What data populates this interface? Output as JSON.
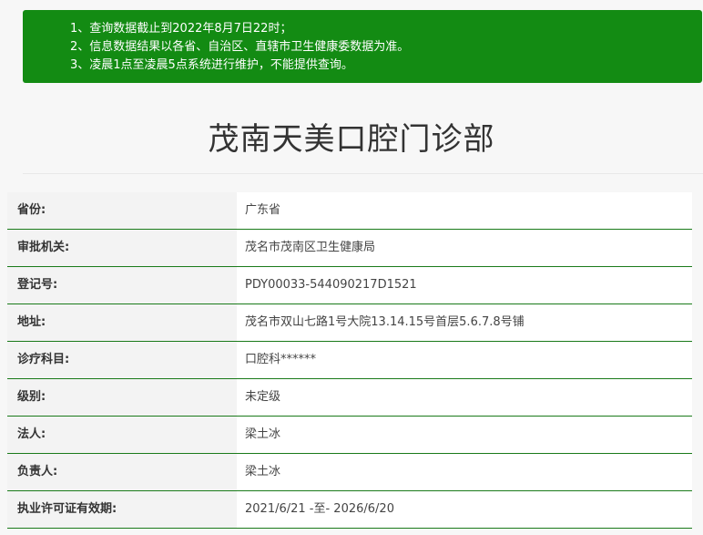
{
  "notice": {
    "lines": [
      "1、查询数据截止到2022年8月7日22时；",
      "2、信息数据结果以各省、自治区、直辖市卫生健康委数据为准。",
      "3、凌晨1点至凌晨5点系统进行维护，不能提供查询。"
    ],
    "background_color": "#138b13"
  },
  "page_title": "茂南天美口腔门诊部",
  "details": [
    {
      "label": "省份:",
      "value": "广东省"
    },
    {
      "label": "审批机关:",
      "value": "茂名市茂南区卫生健康局"
    },
    {
      "label": "登记号:",
      "value": "PDY00033-544090217D1521"
    },
    {
      "label": "地址:",
      "value": "茂名市双山七路1号大院13.14.15号首层5.6.7.8号铺"
    },
    {
      "label": "诊疗科目:",
      "value": "口腔科******"
    },
    {
      "label": "级别:",
      "value": "未定级"
    },
    {
      "label": "法人:",
      "value": "梁土冰"
    },
    {
      "label": "负责人:",
      "value": "梁土冰"
    },
    {
      "label": "执业许可证有效期:",
      "value": "2021/6/21 -至- 2026/6/20"
    }
  ],
  "row_border_color": "#1a7a1a"
}
